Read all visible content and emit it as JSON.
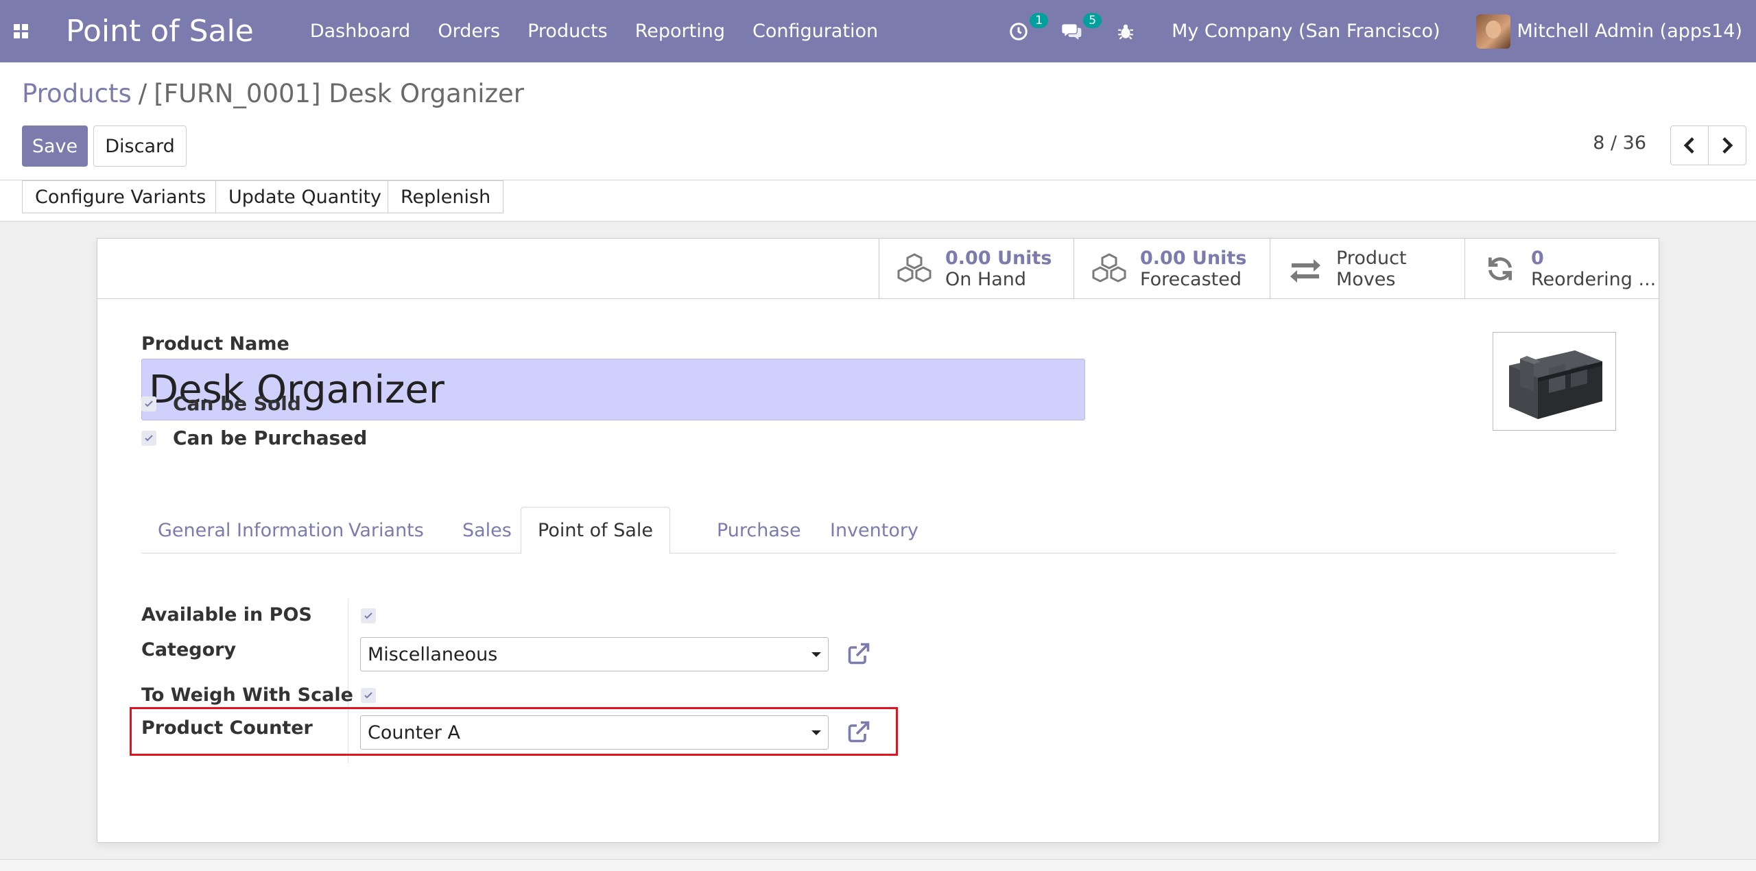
{
  "navbar": {
    "app_name": "Point of Sale",
    "menu": [
      "Dashboard",
      "Orders",
      "Products",
      "Reporting",
      "Configuration"
    ],
    "activity_count": "1",
    "message_count": "5",
    "company": "My Company (San Francisco)",
    "user": "Mitchell Admin (apps14)"
  },
  "breadcrumb": {
    "parent": "Products",
    "separator": "/",
    "current": "[FURN_0001] Desk Organizer"
  },
  "buttons": {
    "save": "Save",
    "discard": "Discard"
  },
  "pager": {
    "value": "8 / 36"
  },
  "actions": [
    "Configure Variants",
    "Update Quantity",
    "Replenish"
  ],
  "stats": [
    {
      "value": "0.00 Units",
      "label": "On Hand",
      "icon": "cubes-icon"
    },
    {
      "value": "0.00 Units",
      "label": "Forecasted",
      "icon": "cubes-icon"
    },
    {
      "value": "Product",
      "label": "Moves",
      "icon": "exchange-icon"
    },
    {
      "value": "0",
      "label": "Reordering ...",
      "icon": "refresh-icon"
    }
  ],
  "form": {
    "product_name_label": "Product Name",
    "product_name": "Desk Organizer",
    "can_be_sold_label": "Can be Sold",
    "can_be_sold": true,
    "can_be_purchased_label": "Can be Purchased",
    "can_be_purchased": true
  },
  "tabs": [
    "General Information",
    "Variants",
    "Sales",
    "Point of Sale",
    "Purchase",
    "Inventory"
  ],
  "active_tab": "Point of Sale",
  "pos_fields": {
    "available_label": "Available in POS",
    "available": true,
    "category_label": "Category",
    "category_value": "Miscellaneous",
    "to_weigh_label": "To Weigh With Scale",
    "to_weigh": true,
    "counter_label": "Product Counter",
    "counter_value": "Counter A"
  },
  "colors": {
    "brand": "#7c7bad",
    "highlight": "#e0141e",
    "badge": "#00a09d"
  }
}
